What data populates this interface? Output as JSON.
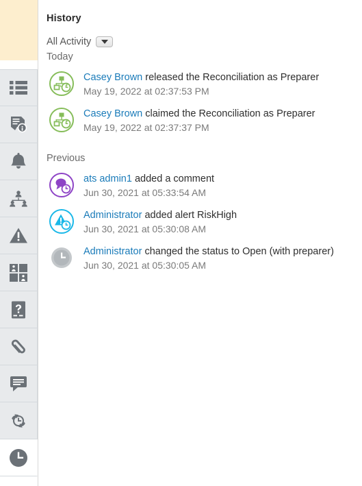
{
  "panel": {
    "title": "History",
    "filter": {
      "label": "All Activity",
      "dropdown_icon": "chevron-down-icon"
    },
    "groups": [
      {
        "label": "Today",
        "entries": [
          {
            "icon": "hierarchy-history-icon",
            "icon_color": "#7cb342",
            "actor": "Casey Brown",
            "action": " released the Reconciliation as Preparer",
            "timestamp": "May 19, 2022 at 02:37:53 PM"
          },
          {
            "icon": "hierarchy-history-icon",
            "icon_color": "#7cb342",
            "actor": "Casey Brown",
            "action": " claimed the Reconciliation as Preparer",
            "timestamp": "May 19, 2022 at 02:37:37 PM"
          }
        ]
      },
      {
        "label": "Previous",
        "entries": [
          {
            "icon": "comment-history-icon",
            "icon_color": "#8e44c6",
            "actor": "ats admin1",
            "action": " added a comment",
            "timestamp": "Jun 30, 2021 at 05:33:54 AM"
          },
          {
            "icon": "alert-history-icon",
            "icon_color": "#1bb8e8",
            "actor": "Administrator",
            "action": " added alert RiskHigh",
            "timestamp": "Jun 30, 2021 at 05:30:08 AM"
          },
          {
            "icon": "clock-status-icon",
            "icon_color": "#b8bcbf",
            "actor": "Administrator",
            "action": " changed the status to Open (with preparer)",
            "timestamp": "Jun 30, 2021 at 05:30:05 AM"
          }
        ]
      }
    ]
  },
  "sidebar": {
    "items": [
      {
        "icon": "list-icon",
        "selected": false
      },
      {
        "icon": "document-info-icon",
        "selected": false
      },
      {
        "icon": "bell-icon",
        "selected": false
      },
      {
        "icon": "org-chart-icon",
        "selected": false
      },
      {
        "icon": "warning-triangle-icon",
        "selected": false
      },
      {
        "icon": "quadrant-people-icon",
        "selected": false
      },
      {
        "icon": "question-document-icon",
        "selected": false
      },
      {
        "icon": "paperclip-icon",
        "selected": false
      },
      {
        "icon": "comment-icon",
        "selected": false
      },
      {
        "icon": "sync-clock-icon",
        "selected": false
      },
      {
        "icon": "history-clock-icon",
        "selected": true
      }
    ]
  },
  "colors": {
    "link": "#1a7bb9",
    "rail_background": "#e8eaec",
    "rail_top_block": "#fdeece",
    "icon_gray": "#6b7177"
  }
}
